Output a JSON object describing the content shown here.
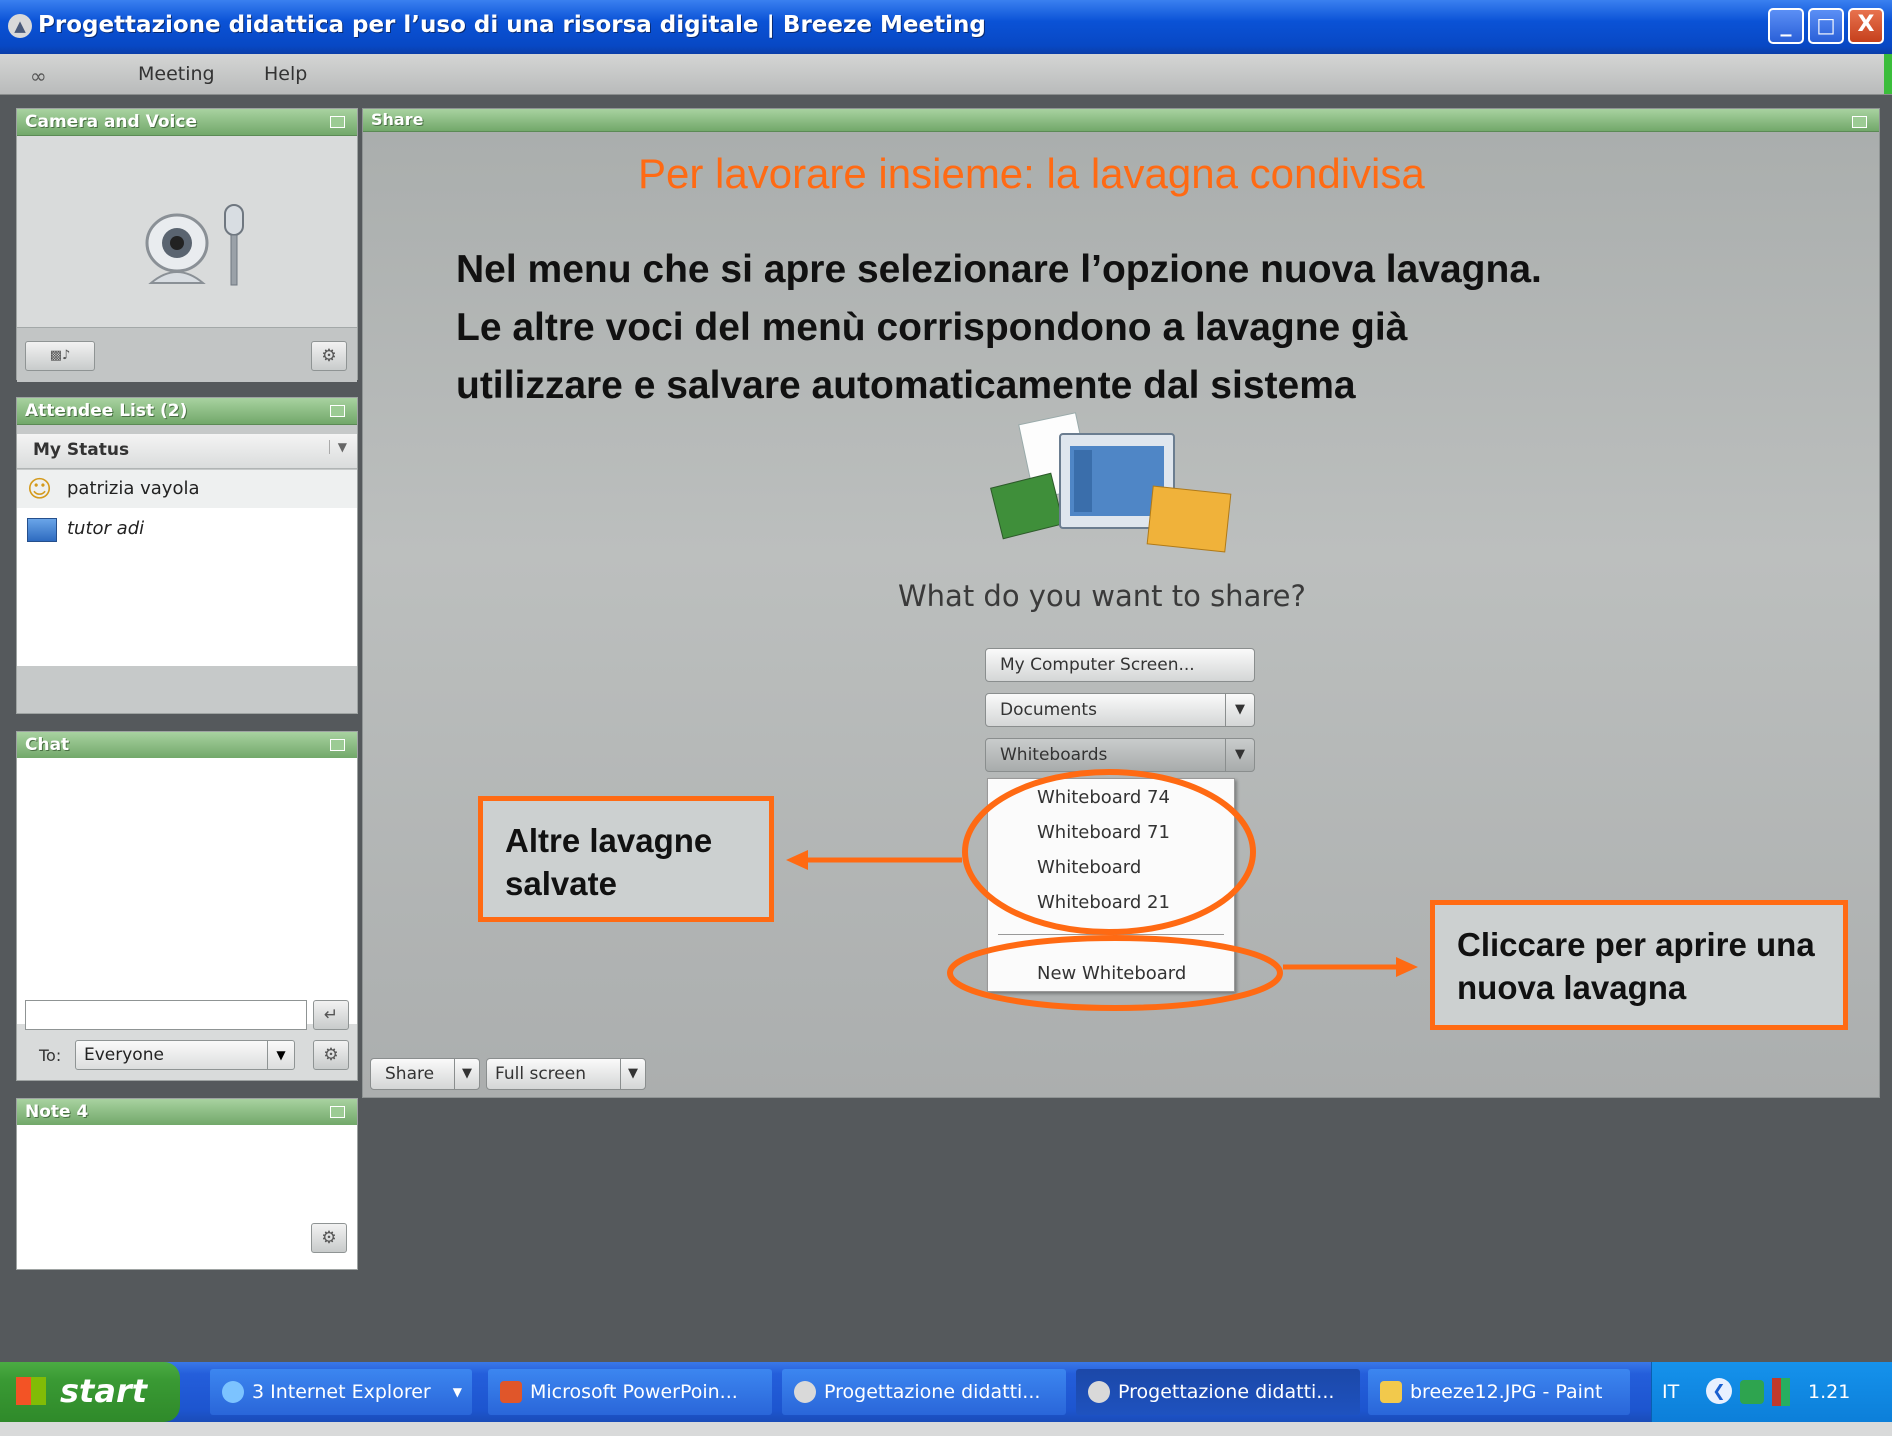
{
  "window": {
    "title": "Progettazione didattica per l’uso di una risorsa digitale | Breeze Meeting",
    "controls": {
      "minimize": "_",
      "maximize": "□",
      "close": "X"
    }
  },
  "menubar": {
    "logo": "∞",
    "items": [
      "Meeting",
      "Help"
    ]
  },
  "pods": {
    "camera": {
      "title": "Camera and Voice"
    },
    "attendees": {
      "title": "Attendee List (2)",
      "status_label": "My Status",
      "people": [
        {
          "name": "patrizia vayola",
          "role": "host"
        },
        {
          "name": "tutor adi",
          "role": "presenter"
        }
      ]
    },
    "chat": {
      "title": "Chat",
      "input_value": "",
      "to_label": "To:",
      "to_value": "Everyone"
    },
    "note": {
      "title": "Note 4"
    }
  },
  "share": {
    "title": "Share",
    "headline": "Per lavorare insieme: la lavagna condivisa",
    "body_lines": [
      "Nel menu che si apre selezionare l’opzione nuova lavagna.",
      "Le altre voci del menù corrispondono a lavagne già",
      "utilizzare e salvare automaticamente dal sistema"
    ],
    "question": "What do you want to share?",
    "buttons": {
      "computer_screen": "My Computer Screen...",
      "documents": "Documents",
      "whiteboards": "Whiteboards"
    },
    "menu_items": [
      "Whiteboard 74",
      "Whiteboard 71",
      "Whiteboard",
      "Whiteboard 21"
    ],
    "new_whiteboard": "New Whiteboard",
    "footer": {
      "share": "Share",
      "fullscreen": "Full screen"
    }
  },
  "callouts": {
    "saved": "Altre lavagne salvate",
    "new": "Cliccare per aprire una nuova lavagna"
  },
  "taskbar": {
    "start": "start",
    "tasks": [
      "3 Internet Explorer",
      "Microsoft PowerPoin...",
      "Progettazione didatti...",
      "Progettazione didatti...",
      "breeze12.JPG - Paint"
    ],
    "lang": "IT",
    "clock": "1.21"
  },
  "colors": {
    "accent_orange": "#ff6a13",
    "pod_header_green": "#86b87e",
    "xp_blue": "#0a52d6"
  }
}
